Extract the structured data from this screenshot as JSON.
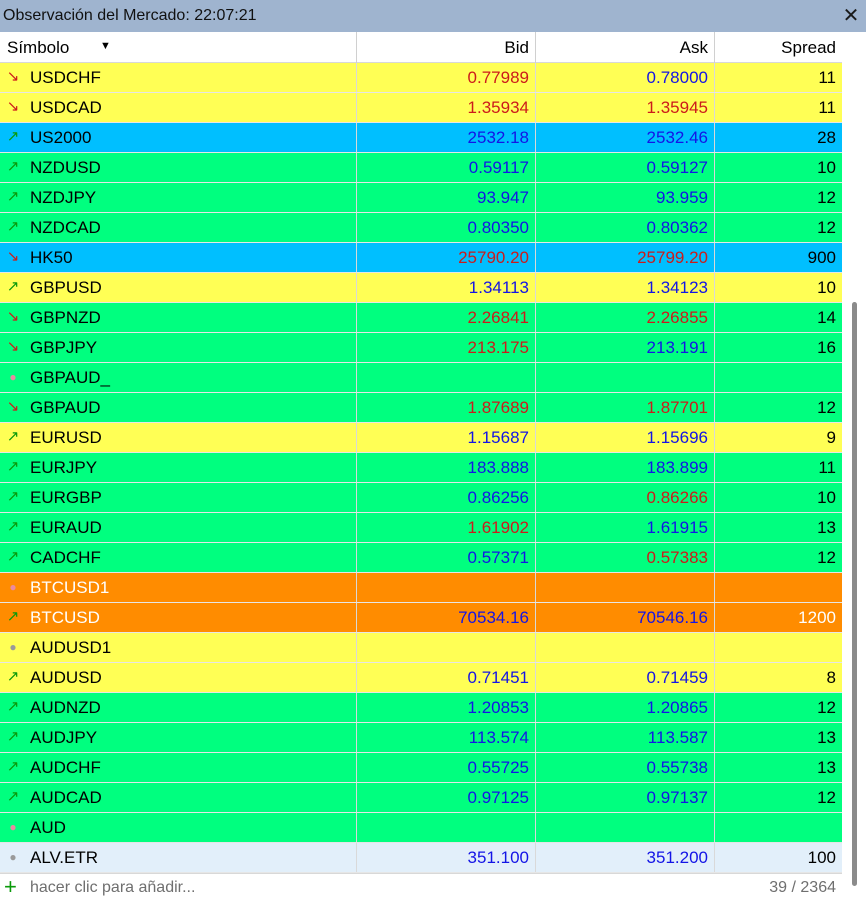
{
  "window": {
    "title": "Observación del Mercado: 22:07:21",
    "close_icon": "close-icon"
  },
  "columns": {
    "symbol": "Símbolo",
    "bid": "Bid",
    "ask": "Ask",
    "spread": "Spread"
  },
  "colors": {
    "yellow": "#ffff55",
    "cyan": "#00bfff",
    "green": "#00ff7f",
    "orange": "#ff8c00",
    "light": "#e2effa",
    "price_up": "#1414e6",
    "price_down": "#cc1b1b"
  },
  "rows": [
    {
      "symbol": "USDCHF",
      "trend": "down",
      "bid": "0.77989",
      "bid_color": "red",
      "ask": "0.78000",
      "ask_color": "blue",
      "spread": "11",
      "bg": "yellow"
    },
    {
      "symbol": "USDCAD",
      "trend": "down",
      "bid": "1.35934",
      "bid_color": "red",
      "ask": "1.35945",
      "ask_color": "red",
      "spread": "11",
      "bg": "yellow"
    },
    {
      "symbol": "US2000",
      "trend": "up",
      "bid": "2532.18",
      "bid_color": "blue",
      "ask": "2532.46",
      "ask_color": "blue",
      "spread": "28",
      "bg": "cyan"
    },
    {
      "symbol": "NZDUSD",
      "trend": "up",
      "bid": "0.59117",
      "bid_color": "blue",
      "ask": "0.59127",
      "ask_color": "blue",
      "spread": "10",
      "bg": "green"
    },
    {
      "symbol": "NZDJPY",
      "trend": "up",
      "bid": "93.947",
      "bid_color": "blue",
      "ask": "93.959",
      "ask_color": "blue",
      "spread": "12",
      "bg": "green"
    },
    {
      "symbol": "NZDCAD",
      "trend": "up",
      "bid": "0.80350",
      "bid_color": "blue",
      "ask": "0.80362",
      "ask_color": "blue",
      "spread": "12",
      "bg": "green"
    },
    {
      "symbol": "HK50",
      "trend": "down",
      "bid": "25790.20",
      "bid_color": "red",
      "ask": "25799.20",
      "ask_color": "red",
      "spread": "900",
      "bg": "cyan"
    },
    {
      "symbol": "GBPUSD",
      "trend": "up",
      "bid": "1.34113",
      "bid_color": "blue",
      "ask": "1.34123",
      "ask_color": "blue",
      "spread": "10",
      "bg": "yellow"
    },
    {
      "symbol": "GBPNZD",
      "trend": "down",
      "bid": "2.26841",
      "bid_color": "red",
      "ask": "2.26855",
      "ask_color": "red",
      "spread": "14",
      "bg": "green"
    },
    {
      "symbol": "GBPJPY",
      "trend": "down",
      "bid": "213.175",
      "bid_color": "red",
      "ask": "213.191",
      "ask_color": "blue",
      "spread": "16",
      "bg": "green"
    },
    {
      "symbol": "GBPAUD_",
      "trend": "none-light",
      "bid": "",
      "bid_color": "blue",
      "ask": "",
      "ask_color": "blue",
      "spread": "",
      "bg": "green"
    },
    {
      "symbol": "GBPAUD",
      "trend": "down",
      "bid": "1.87689",
      "bid_color": "red",
      "ask": "1.87701",
      "ask_color": "red",
      "spread": "12",
      "bg": "green"
    },
    {
      "symbol": "EURUSD",
      "trend": "up",
      "bid": "1.15687",
      "bid_color": "blue",
      "ask": "1.15696",
      "ask_color": "blue",
      "spread": "9",
      "bg": "yellow"
    },
    {
      "symbol": "EURJPY",
      "trend": "up",
      "bid": "183.888",
      "bid_color": "blue",
      "ask": "183.899",
      "ask_color": "blue",
      "spread": "11",
      "bg": "green"
    },
    {
      "symbol": "EURGBP",
      "trend": "up",
      "bid": "0.86256",
      "bid_color": "blue",
      "ask": "0.86266",
      "ask_color": "red",
      "spread": "10",
      "bg": "green"
    },
    {
      "symbol": "EURAUD",
      "trend": "up",
      "bid": "1.61902",
      "bid_color": "red",
      "ask": "1.61915",
      "ask_color": "blue",
      "spread": "13",
      "bg": "green"
    },
    {
      "symbol": "CADCHF",
      "trend": "up",
      "bid": "0.57371",
      "bid_color": "blue",
      "ask": "0.57383",
      "ask_color": "red",
      "spread": "12",
      "bg": "green"
    },
    {
      "symbol": "BTCUSD1",
      "trend": "none-light",
      "bid": "",
      "bid_color": "blue",
      "ask": "",
      "ask_color": "blue",
      "spread": "",
      "bg": "orange",
      "text_color": "white"
    },
    {
      "symbol": "BTCUSD",
      "trend": "up",
      "bid": "70534.16",
      "bid_color": "blue",
      "ask": "70546.16",
      "ask_color": "blue",
      "spread": "1200",
      "bg": "orange",
      "text_color": "white"
    },
    {
      "symbol": "AUDUSD1",
      "trend": "none",
      "bid": "",
      "bid_color": "blue",
      "ask": "",
      "ask_color": "blue",
      "spread": "",
      "bg": "yellow"
    },
    {
      "symbol": "AUDUSD",
      "trend": "up",
      "bid": "0.71451",
      "bid_color": "blue",
      "ask": "0.71459",
      "ask_color": "blue",
      "spread": "8",
      "bg": "yellow"
    },
    {
      "symbol": "AUDNZD",
      "trend": "up",
      "bid": "1.20853",
      "bid_color": "blue",
      "ask": "1.20865",
      "ask_color": "blue",
      "spread": "12",
      "bg": "green"
    },
    {
      "symbol": "AUDJPY",
      "trend": "up",
      "bid": "113.574",
      "bid_color": "blue",
      "ask": "113.587",
      "ask_color": "blue",
      "spread": "13",
      "bg": "green"
    },
    {
      "symbol": "AUDCHF",
      "trend": "up",
      "bid": "0.55725",
      "bid_color": "blue",
      "ask": "0.55738",
      "ask_color": "blue",
      "spread": "13",
      "bg": "green"
    },
    {
      "symbol": "AUDCAD",
      "trend": "up",
      "bid": "0.97125",
      "bid_color": "blue",
      "ask": "0.97137",
      "ask_color": "blue",
      "spread": "12",
      "bg": "green"
    },
    {
      "symbol": "AUD",
      "trend": "none-light",
      "bid": "",
      "bid_color": "blue",
      "ask": "",
      "ask_color": "blue",
      "spread": "",
      "bg": "green"
    },
    {
      "symbol": "ALV.ETR",
      "trend": "none",
      "bid": "351.100",
      "bid_color": "blue",
      "ask": "351.200",
      "ask_color": "blue",
      "spread": "100",
      "bg": "light"
    }
  ],
  "footer": {
    "add_label": "hacer clic para añadir...",
    "count": "39 / 2364"
  }
}
